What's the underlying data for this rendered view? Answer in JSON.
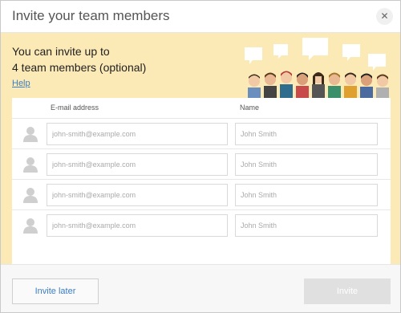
{
  "dialog": {
    "title": "Invite your team members",
    "close_icon": "close-icon"
  },
  "intro": {
    "line1": "You can invite up to",
    "line2": "4 team members (optional)",
    "help_link": "Help",
    "illustration": "team-illustration"
  },
  "table": {
    "columns": [
      "E-mail address",
      "Name"
    ],
    "rows": [
      {
        "email_placeholder": "john-smith@example.com",
        "name_placeholder": "John Smith",
        "email_value": "",
        "name_value": ""
      },
      {
        "email_placeholder": "john-smith@example.com",
        "name_placeholder": "John Smith",
        "email_value": "",
        "name_value": ""
      },
      {
        "email_placeholder": "john-smith@example.com",
        "name_placeholder": "John Smith",
        "email_value": "",
        "name_value": ""
      },
      {
        "email_placeholder": "john-smith@example.com",
        "name_placeholder": "John Smith",
        "email_value": "",
        "name_value": ""
      }
    ]
  },
  "footer": {
    "invite_later_label": "Invite later",
    "invite_label": "Invite"
  },
  "colors": {
    "banner_bg": "#fbe9b6",
    "link": "#3b7dc4",
    "disabled_button": "#e0e0e0"
  }
}
